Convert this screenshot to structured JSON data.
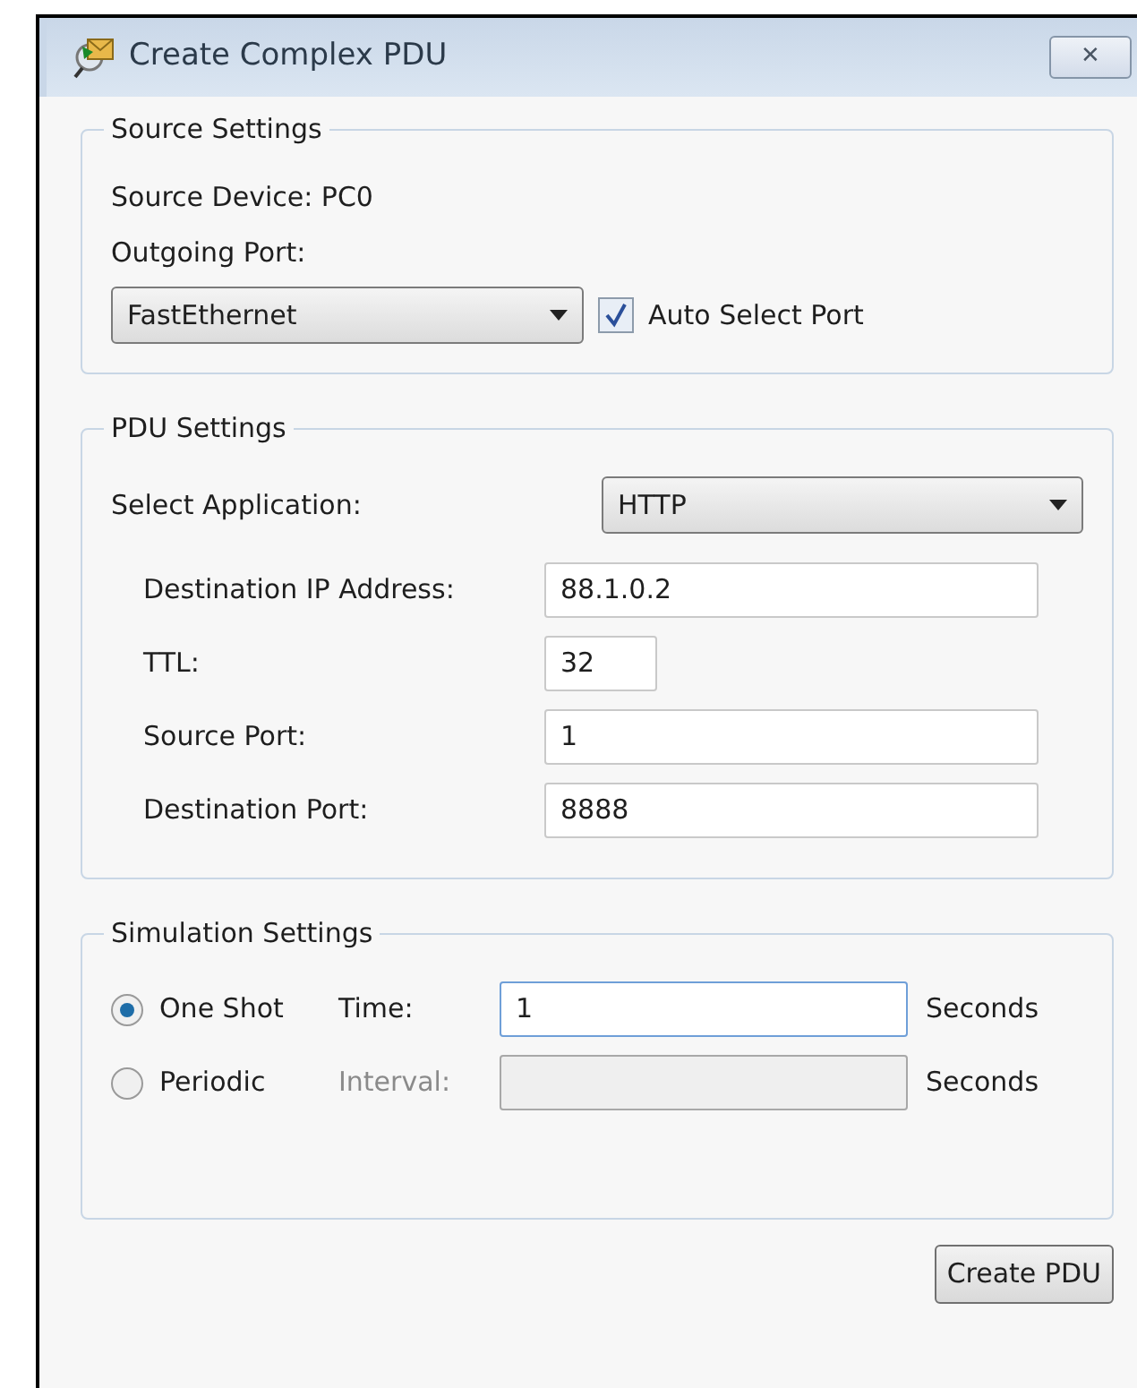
{
  "window": {
    "title": "Create Complex PDU",
    "close": "✕"
  },
  "source_settings": {
    "title": "Source Settings",
    "device_label": "Source Device: PC0",
    "port_label": "Outgoing Port:",
    "port_value": "FastEthernet",
    "auto_select": {
      "label": "Auto Select Port",
      "checked": true
    }
  },
  "pdu_settings": {
    "title": "PDU Settings",
    "app_label": "Select Application:",
    "app_value": "HTTP",
    "fields": [
      {
        "label": "Destination IP Address:",
        "value": "88.1.0.2",
        "kind": "wide"
      },
      {
        "label": "TTL:",
        "value": "32",
        "kind": "narrow"
      },
      {
        "label": "Source Port:",
        "value": "1",
        "kind": "wide"
      },
      {
        "label": "Destination Port:",
        "value": "8888",
        "kind": "wide"
      }
    ]
  },
  "simulation_settings": {
    "title": "Simulation Settings",
    "modes": [
      {
        "label": "One Shot",
        "selected": true,
        "field_label": "Time:",
        "value": "1",
        "disabled": false,
        "focused": true,
        "unit": "Seconds"
      },
      {
        "label": "Periodic",
        "selected": false,
        "field_label": "Interval:",
        "disabled": true,
        "focused": false,
        "unit": "Seconds"
      }
    ]
  },
  "buttons": [
    "Create PDU"
  ]
}
